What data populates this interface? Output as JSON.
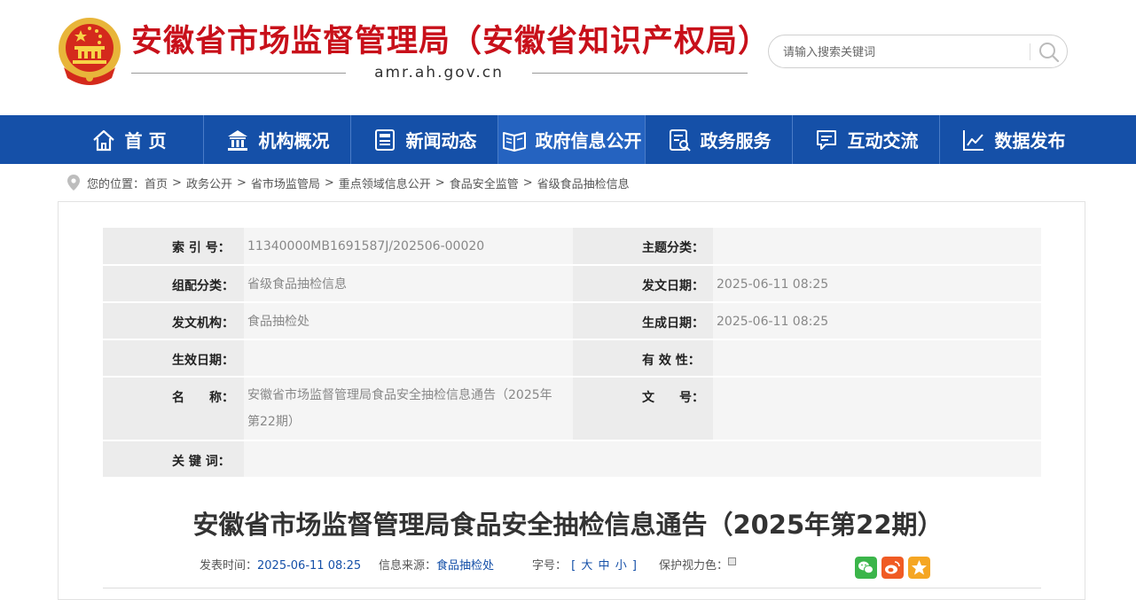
{
  "header": {
    "site_title": "安徽省市场监督管理局（安徽省知识产权局）",
    "domain": "amr.ah.gov.cn",
    "search_placeholder": "请输入搜索关键词",
    "emblem_icon": "national-emblem-icon"
  },
  "nav": {
    "items": [
      {
        "label": "首 页",
        "icon": "home-icon"
      },
      {
        "label": "机构概况",
        "icon": "institution-icon"
      },
      {
        "label": "新闻动态",
        "icon": "news-icon"
      },
      {
        "label": "政府信息公开",
        "icon": "open-book-icon",
        "active": true
      },
      {
        "label": "政务服务",
        "icon": "service-doc-icon"
      },
      {
        "label": "互动交流",
        "icon": "chat-icon"
      },
      {
        "label": "数据发布",
        "icon": "chart-icon"
      }
    ],
    "bg_color": "#1550a8",
    "active_color": "#2563c0"
  },
  "breadcrumb": {
    "prefix": "您的位置：",
    "items": [
      "首页",
      "政务公开",
      "省市场监管局",
      "重点领域信息公开",
      "食品安全监管",
      "省级食品抽检信息"
    ]
  },
  "meta": {
    "index_label": "索 引 号：",
    "index_value": "11340000MB1691587J/202506-00020",
    "topic_label": "主题分类：",
    "topic_value": "",
    "group_label": "组配分类：",
    "group_value": "省级食品抽检信息",
    "issue_date_label": "发文日期：",
    "issue_date_value": "2025-06-11 08:25",
    "org_label": "发文机构：",
    "org_value": "食品抽检处",
    "gen_date_label": "生成日期：",
    "gen_date_value": "2025-06-11 08:25",
    "effective_label": "生效日期：",
    "effective_value": "",
    "validity_label": "有 效 性：",
    "validity_value": "",
    "name_label": "名　　称：",
    "name_value": "安徽省市场监督管理局食品安全抽检信息通告（2025年第22期）",
    "doc_no_label": "文　　号：",
    "doc_no_value": "",
    "keywords_label": "关 键 词：",
    "keywords_value": ""
  },
  "article": {
    "title": "安徽省市场监督管理局食品安全抽检信息通告（2025年第22期）",
    "publish_label": "发表时间：",
    "publish_time": "2025-06-11 08:25",
    "source_label": "信息来源：",
    "source": "食品抽检处",
    "font_label": "字号：",
    "font_open": "[",
    "font_large": "大",
    "font_medium": "中",
    "font_small": "小",
    "font_close": "]",
    "eye_label": "保护视力色：",
    "eye_colors": [
      "#ffffff",
      "#faf9de",
      "#fff2e2",
      "#fde6e0",
      "#f3ffe1",
      "#dafaf8",
      "#eaeaef",
      "#e6e6e6"
    ],
    "share": [
      {
        "icon": "wechat-icon",
        "color": "#3bb54a"
      },
      {
        "icon": "weibo-icon",
        "color": "#f05b24"
      },
      {
        "icon": "star-icon",
        "color": "#f5a623"
      }
    ]
  }
}
